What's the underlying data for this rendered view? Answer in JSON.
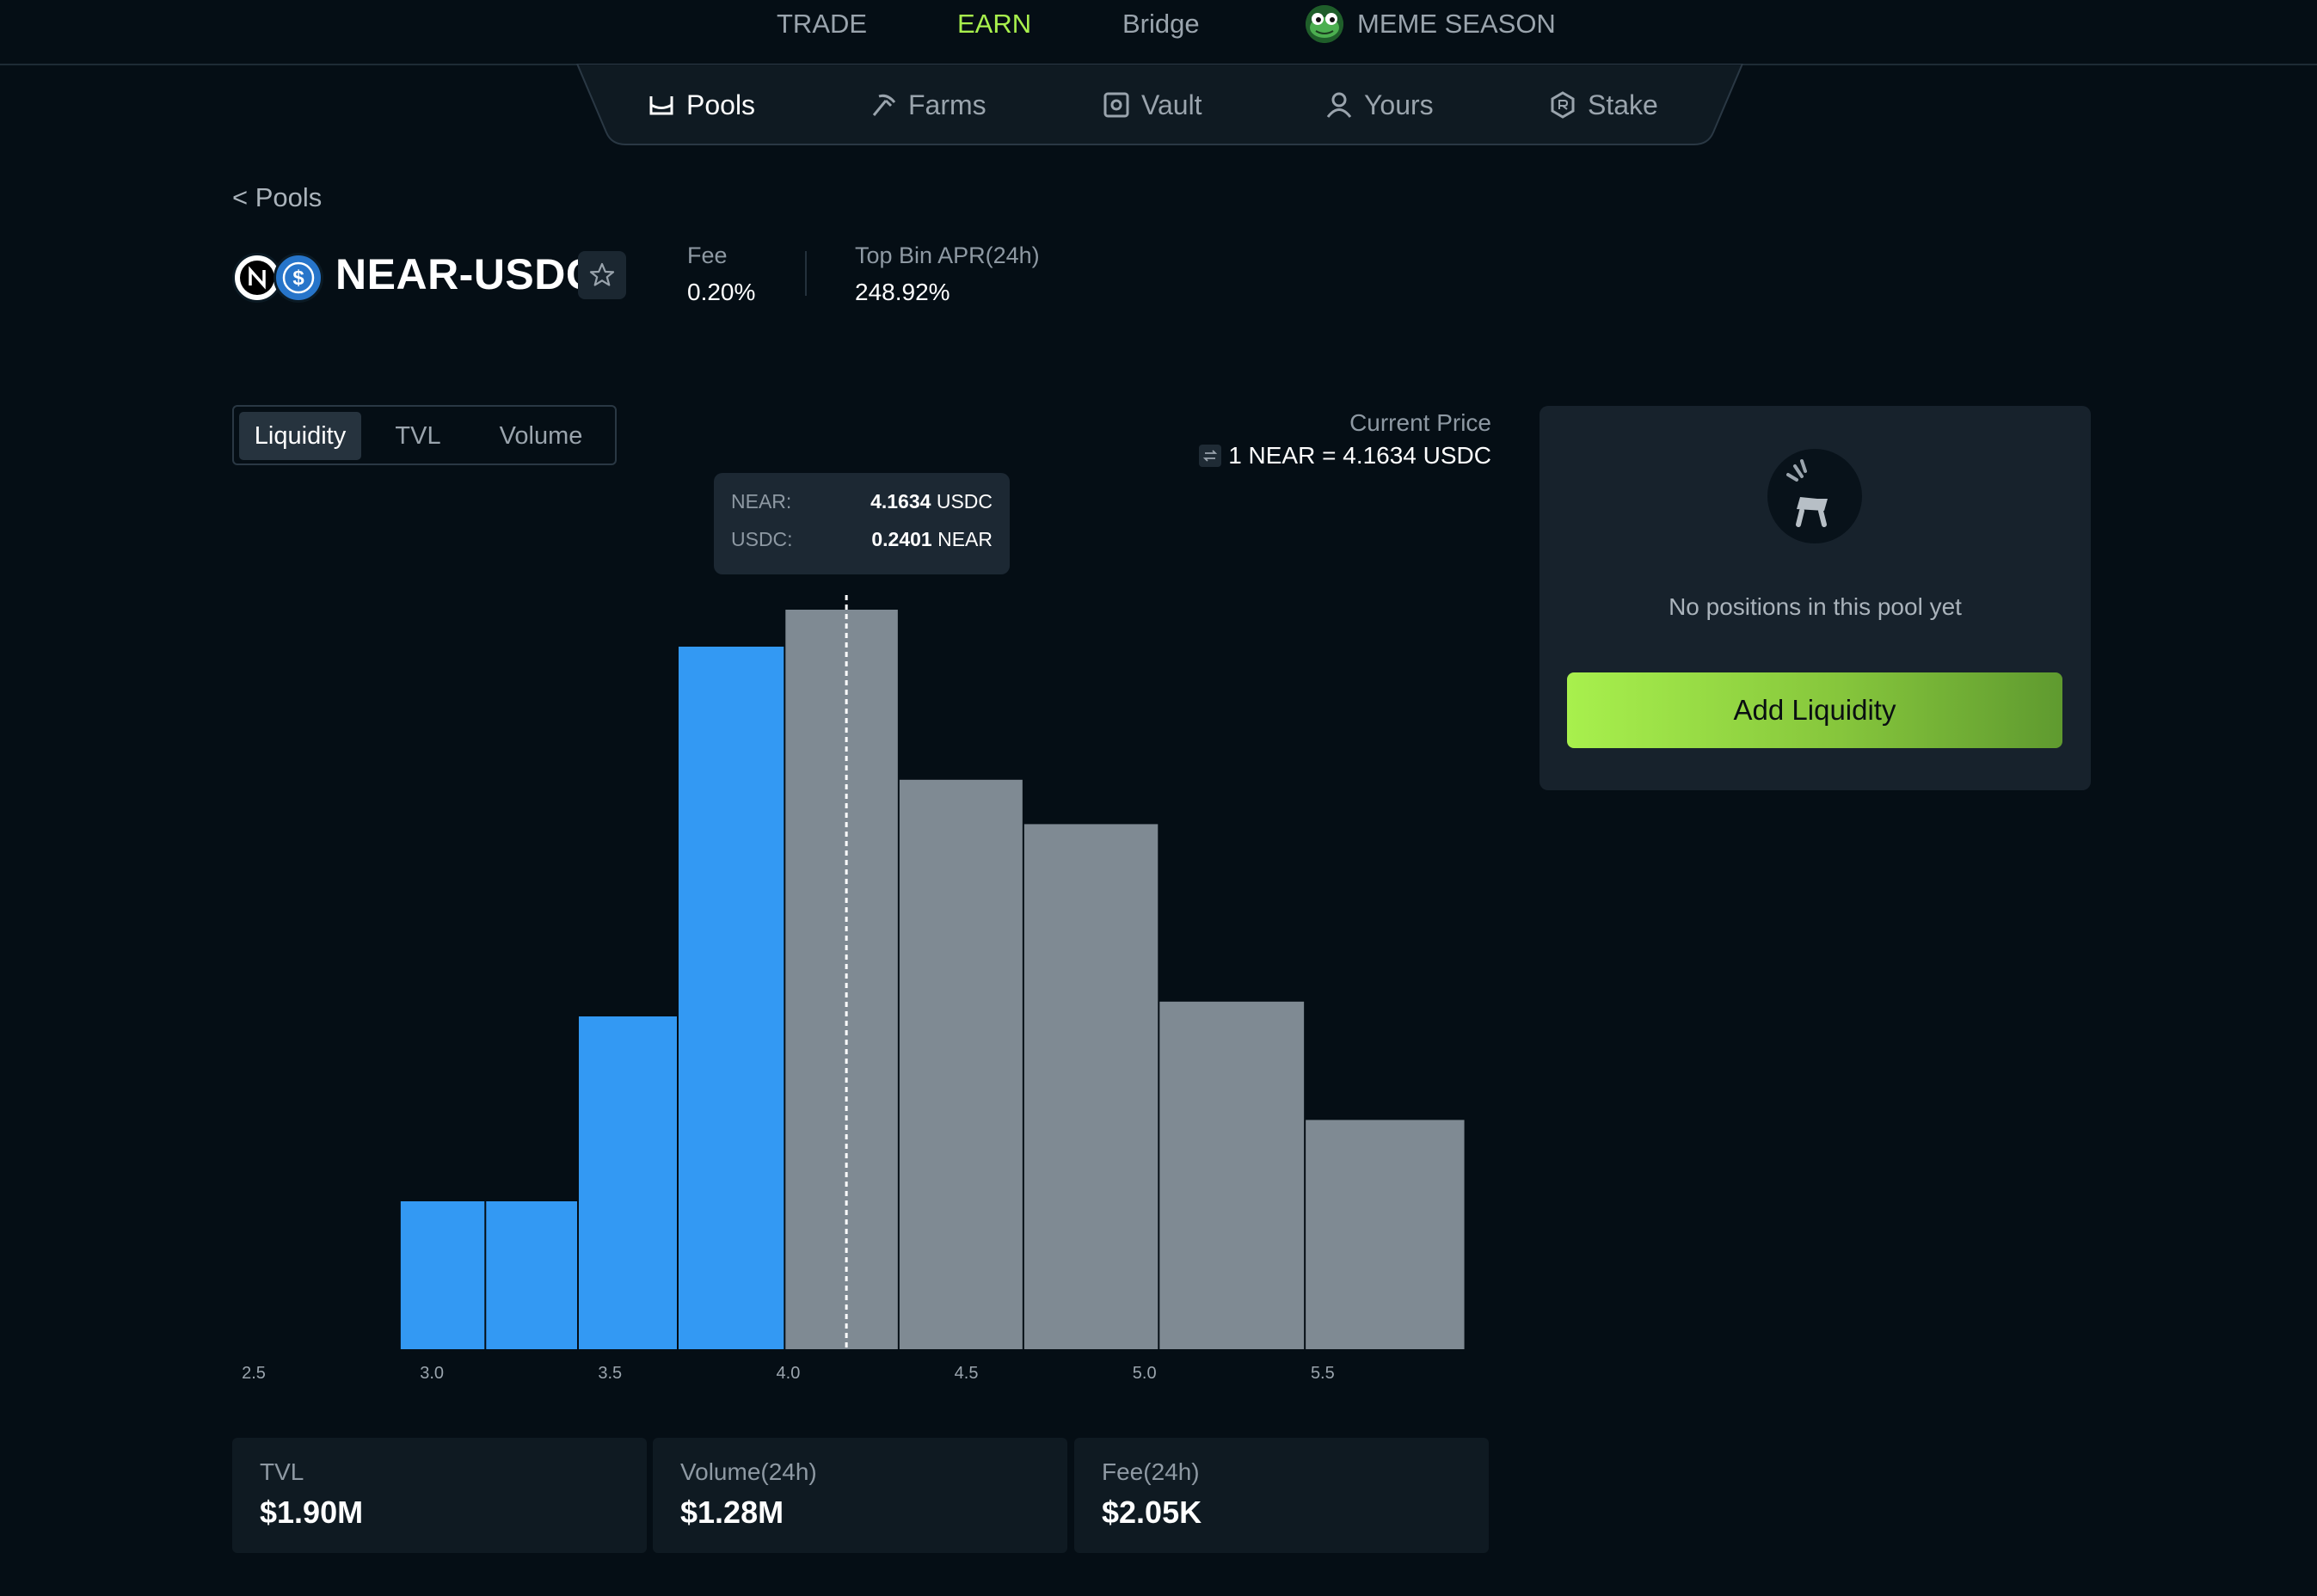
{
  "top_nav": {
    "items": [
      {
        "label": "TRADE",
        "active": false
      },
      {
        "label": "EARN",
        "active": true
      },
      {
        "label": "Bridge",
        "active": false
      },
      {
        "label": "MEME SEASON",
        "active": false,
        "icon": "frog-icon"
      }
    ]
  },
  "sub_nav": {
    "items": [
      {
        "label": "Pools",
        "icon": "pools-icon",
        "active": true
      },
      {
        "label": "Farms",
        "icon": "pickaxe-icon",
        "active": false
      },
      {
        "label": "Vault",
        "icon": "vault-icon",
        "active": false
      },
      {
        "label": "Yours",
        "icon": "user-icon",
        "active": false
      },
      {
        "label": "Stake",
        "icon": "stake-icon",
        "active": false
      }
    ]
  },
  "back_link": "< Pools",
  "pool": {
    "name": "NEAR-USDC",
    "tokens": [
      "near-token-icon",
      "usdc-token-icon"
    ],
    "fee_label": "Fee",
    "fee_value": "0.20%",
    "apr_label": "Top Bin APR(24h)",
    "apr_value": "248.92%"
  },
  "chart_tabs": [
    "Liquidity",
    "TVL",
    "Volume"
  ],
  "active_tab": "Liquidity",
  "current_price": {
    "label": "Current Price",
    "value": "1 NEAR = 4.1634 USDC"
  },
  "tooltip": {
    "near_key": "NEAR:",
    "near_value": "4.1634",
    "near_unit": "USDC",
    "usdc_key": "USDC:",
    "usdc_value": "0.2401",
    "usdc_unit": "NEAR"
  },
  "chart_data": {
    "type": "bar",
    "xlim": [
      2.5,
      6.0
    ],
    "x_ticks": [
      "2.5",
      "3.0",
      "3.5",
      "4.0",
      "4.5",
      "5.0",
      "5.5"
    ],
    "current_price": 4.1634,
    "colors": {
      "below_price": "#3399f3",
      "above_price": "#7f8a93"
    },
    "bins": [
      {
        "x0": 2.91,
        "x1": 3.15,
        "value": 20
      },
      {
        "x0": 3.15,
        "x1": 3.41,
        "value": 20
      },
      {
        "x0": 3.41,
        "x1": 3.69,
        "value": 45
      },
      {
        "x0": 3.69,
        "x1": 3.99,
        "value": 95
      },
      {
        "x0": 3.99,
        "x1": 4.31,
        "value": 100
      },
      {
        "x0": 4.31,
        "x1": 4.66,
        "value": 77
      },
      {
        "x0": 4.66,
        "x1": 5.04,
        "value": 71
      },
      {
        "x0": 5.04,
        "x1": 5.45,
        "value": 47
      },
      {
        "x0": 5.45,
        "x1": 5.9,
        "value": 31
      }
    ]
  },
  "positions": {
    "empty_text": "No positions in this pool yet",
    "add_button": "Add Liquidity"
  },
  "stats": [
    {
      "label": "TVL",
      "value": "$1.90M"
    },
    {
      "label": "Volume(24h)",
      "value": "$1.28M"
    },
    {
      "label": "Fee(24h)",
      "value": "$2.05K"
    }
  ]
}
